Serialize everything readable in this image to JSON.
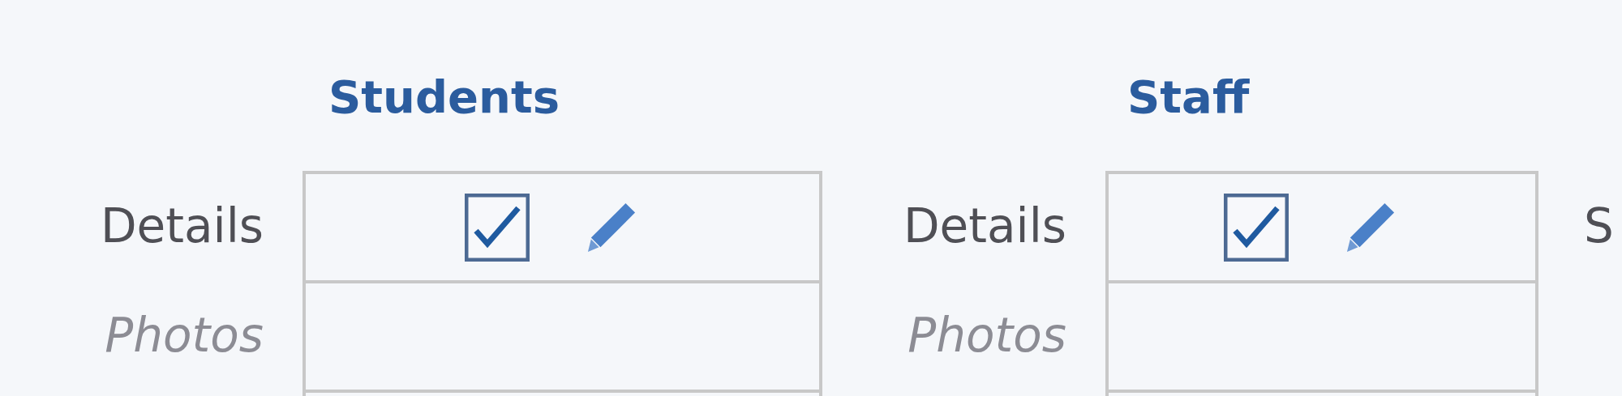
{
  "sections": [
    {
      "title": "Students",
      "rows": [
        {
          "label": "Details",
          "disabled": false,
          "checked": true,
          "editable": true
        },
        {
          "label": "Photos",
          "disabled": true
        },
        {}
      ]
    },
    {
      "title": "Staff",
      "rows": [
        {
          "label": "Details",
          "disabled": false,
          "checked": true,
          "editable": true
        },
        {
          "label": "Photos",
          "disabled": true
        },
        {}
      ]
    },
    {
      "rows": [
        {
          "label": "S",
          "disabled": false
        }
      ]
    }
  ]
}
